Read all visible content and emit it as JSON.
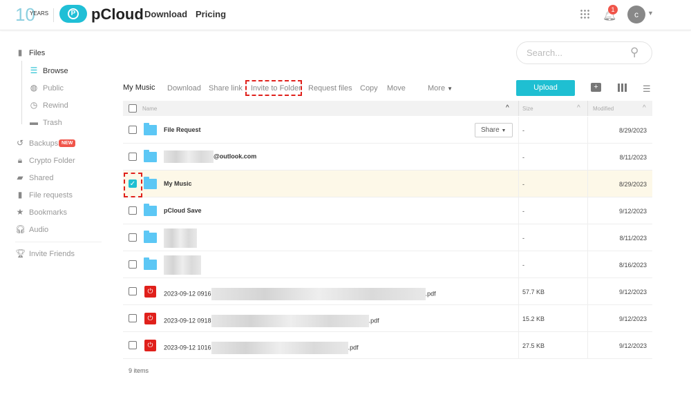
{
  "header": {
    "logo_years": "YEARS",
    "brand": "pCloud",
    "nav": [
      "Download",
      "Pricing"
    ],
    "notifications": "1",
    "avatar": "c"
  },
  "search": {
    "placeholder": "Search..."
  },
  "sidebar": {
    "files": "Files",
    "sub": [
      "Browse",
      "Public",
      "Rewind",
      "Trash"
    ],
    "items": [
      "Backups",
      "Crypto Folder",
      "Shared",
      "File requests",
      "Bookmarks",
      "Audio"
    ],
    "new_badge": "NEW",
    "invite": "Invite Friends"
  },
  "toolbar": {
    "folder": "My Music",
    "actions": [
      "Download",
      "Share link",
      "Invite to Folder",
      "Request files",
      "Copy",
      "Move"
    ],
    "more": "More",
    "upload": "Upload"
  },
  "table": {
    "headers": {
      "name": "Name",
      "size": "Size",
      "modified": "Modified"
    },
    "share_label": "Share",
    "rows": [
      {
        "name": "File Request",
        "size": "-",
        "modified": "8/29/2023",
        "type": "folder"
      },
      {
        "name": "@outlook.com",
        "size": "-",
        "modified": "8/11/2023",
        "type": "folder"
      },
      {
        "name": "My Music",
        "size": "-",
        "modified": "8/29/2023",
        "type": "folder",
        "selected": true
      },
      {
        "name": "pCloud Save",
        "size": "-",
        "modified": "9/12/2023",
        "type": "folder"
      },
      {
        "name": "",
        "size": "-",
        "modified": "8/11/2023",
        "type": "folder"
      },
      {
        "name": "",
        "size": "-",
        "modified": "8/16/2023",
        "type": "folder"
      },
      {
        "name": "2023-09-12 0916",
        "ext": ".pdf",
        "size": "57.7 KB",
        "modified": "9/12/2023",
        "type": "pdf"
      },
      {
        "name": "2023-09-12 0918",
        "ext": ".pdf",
        "size": "15.2 KB",
        "modified": "9/12/2023",
        "type": "pdf"
      },
      {
        "name": "2023-09-12 1016",
        "ext": ".pdf",
        "size": "27.5 KB",
        "modified": "9/12/2023",
        "type": "pdf"
      }
    ]
  },
  "footer": {
    "count": "9 items"
  },
  "colors": {
    "accent": "#1fbfd2",
    "highlight": "#e0201b",
    "selected_row": "#fdf8e8"
  }
}
